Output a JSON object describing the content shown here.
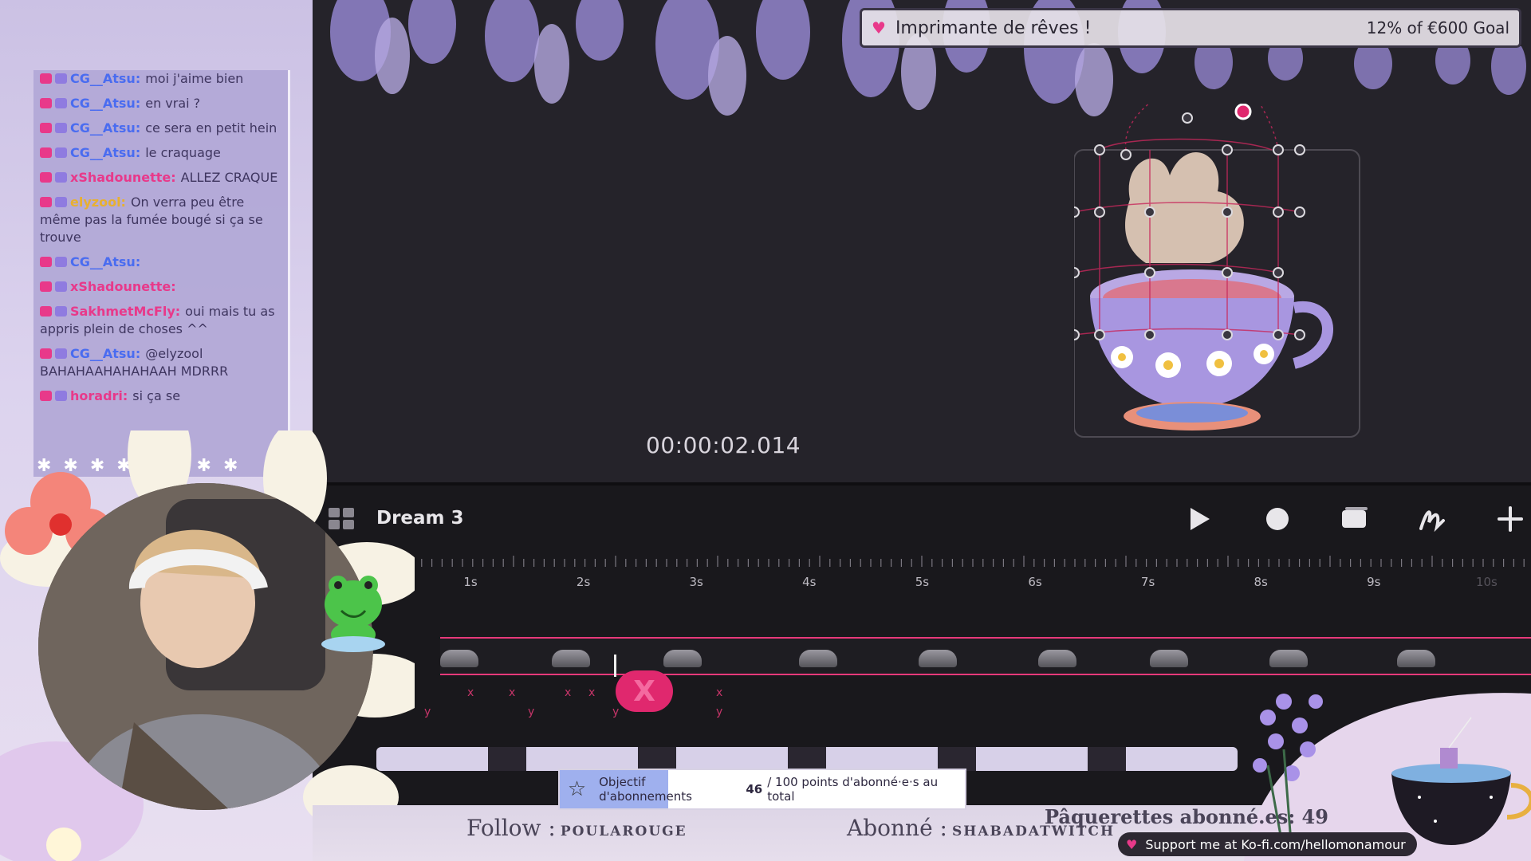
{
  "chat": {
    "messages": [
      {
        "user": "CG__Atsu:",
        "text": "moi j'aime bien",
        "color": "#4a6cf0"
      },
      {
        "user": "CG__Atsu:",
        "text": "en vrai ?",
        "color": "#4a6cf0"
      },
      {
        "user": "CG__Atsu:",
        "text": "ce sera en petit hein",
        "color": "#4a6cf0"
      },
      {
        "user": "CG__Atsu:",
        "text": "le craquage",
        "color": "#4a6cf0"
      },
      {
        "user": "xShadounette:",
        "text": "ALLEZ CRAQUE",
        "color": "#e8398a"
      },
      {
        "user": "elyzool:",
        "text": "On verra peu être même pas la fumée bougé si ça se trouve",
        "color": "#e8b030"
      },
      {
        "user": "CG__Atsu:",
        "text": "",
        "color": "#4a6cf0"
      },
      {
        "user": "xShadounette:",
        "text": "",
        "color": "#e8398a"
      },
      {
        "user": "SakhmetMcFly:",
        "text": "oui mais tu as appris plein de choses ^^",
        "color": "#e8398a"
      },
      {
        "user": "CG__Atsu:",
        "text": "@elyzool BAHAHAAHAHAHAAH MDRRR",
        "color": "#4a6cf0"
      },
      {
        "user": "horadri:",
        "text": "si ça se",
        "color": "#e8398a"
      }
    ]
  },
  "goal": {
    "title": "Imprimante de rêves !",
    "progress_text": "12% of €600 Goal"
  },
  "canvas": {
    "timecode": "00:00:02.014"
  },
  "timeline": {
    "project_name": "Dream 3",
    "ticks": [
      "1s",
      "2s",
      "3s",
      "4s",
      "5s",
      "6s",
      "7s",
      "8s",
      "9s",
      "10s"
    ],
    "key_label": "X"
  },
  "sub_goal": {
    "label": "Objectif d'abonnements",
    "current": "46",
    "rest": "/ 100 points d'abonné·e·s au total",
    "progress": 0.46
  },
  "footer": {
    "follow_label": "Follow :",
    "follow_name": "POULAROUGE",
    "sub_label": "Abonné :",
    "sub_name": "SHABADATWITCH",
    "paquerettes": "Pâquerettes abonné.es: 49",
    "kofi": "Support me at Ko-fi.com/hellomonamour"
  },
  "colors": {
    "accent": "#e8397a",
    "purple": "#8f7be0"
  }
}
